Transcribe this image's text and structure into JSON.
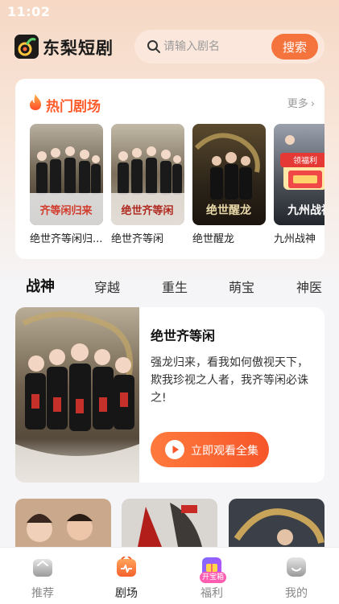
{
  "status_bar": {
    "time": "11:02"
  },
  "header": {
    "app_name": "东梨短剧",
    "search_placeholder": "请输入剧名",
    "search_button": "搜索"
  },
  "hot_section": {
    "title": "热门剧场",
    "more_label": "更多",
    "items": [
      {
        "label": "绝世齐等闲归...",
        "poster_text": "齐等闲归来"
      },
      {
        "label": "绝世齐等闲",
        "poster_text": "绝世齐等闲"
      },
      {
        "label": "绝世醒龙",
        "poster_text": "绝世醒龙"
      },
      {
        "label": "九州战神",
        "poster_text": "九州战神",
        "badge": "领福利"
      }
    ]
  },
  "category_tabs": [
    {
      "label": "战神",
      "active": true
    },
    {
      "label": "穿越",
      "active": false
    },
    {
      "label": "重生",
      "active": false
    },
    {
      "label": "萌宝",
      "active": false
    },
    {
      "label": "神医",
      "active": false
    }
  ],
  "featured": {
    "title": "绝世齐等闲",
    "description": "强龙归来，看我如何傲视天下，欺我珍视之人者，我齐等闲必诛之!",
    "button_label": "立即观看全集"
  },
  "bottom_nav": [
    {
      "label": "推荐",
      "icon": "home-icon",
      "active": false
    },
    {
      "label": "剧场",
      "icon": "theater-icon",
      "active": true
    },
    {
      "label": "福利",
      "icon": "gift-icon",
      "active": false,
      "badge": "开宝箱"
    },
    {
      "label": "我的",
      "icon": "profile-icon",
      "active": false
    }
  ],
  "colors": {
    "accent": "#f5733c",
    "hot_title": "#ff5a2a",
    "badge_pink": "#ff5db1"
  }
}
